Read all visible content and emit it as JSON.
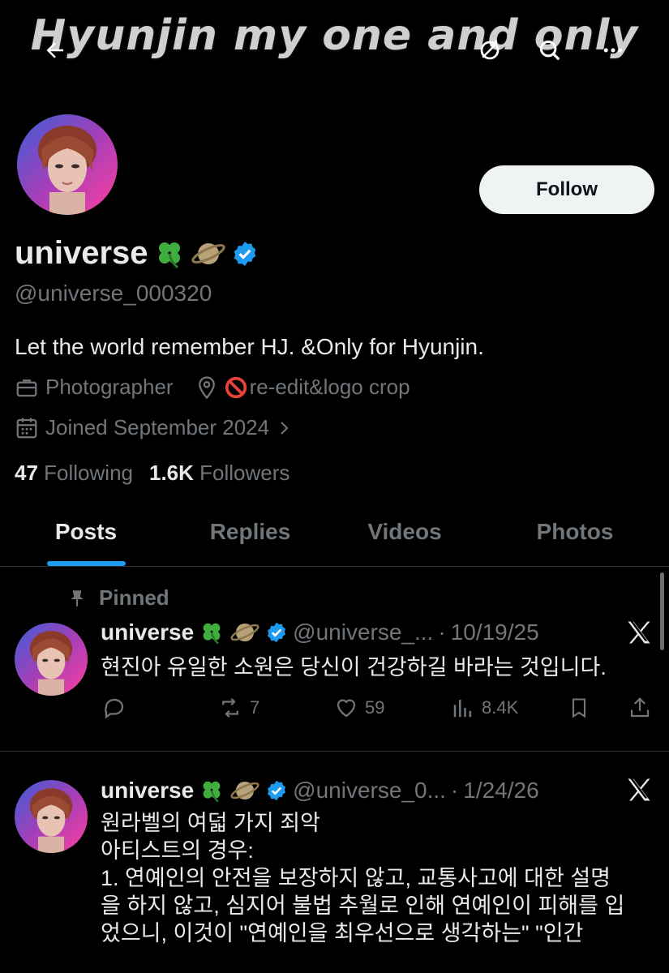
{
  "banner": {
    "title": "Hyunjin my one and only"
  },
  "header": {
    "back": "back",
    "refresh": "refresh",
    "search": "search",
    "more": "more"
  },
  "profile": {
    "display_name": "universe",
    "handle": "@universe_000320",
    "bio": "Let the world remember HJ. &Only for Hyunjin.",
    "category": "Photographer",
    "location": "re-edit&logo crop",
    "joined": "Joined September 2024",
    "following_count": "47",
    "following_label": "Following",
    "followers_count": "1.6K",
    "followers_label": "Followers",
    "follow_button": "Follow"
  },
  "tabs": [
    {
      "label": "Posts",
      "active": true
    },
    {
      "label": "Replies",
      "active": false
    },
    {
      "label": "Videos",
      "active": false
    },
    {
      "label": "Photos",
      "active": false
    }
  ],
  "posts": [
    {
      "pinned_label": "Pinned",
      "name": "universe",
      "handle": "@universe_...",
      "sep": "·",
      "date": "10/19/25",
      "text": "현진아 유일한 소원은 당신이 건강하길 바라는 것입니다.",
      "replies": "",
      "reposts": "7",
      "likes": "59",
      "views": "8.4K"
    },
    {
      "name": "universe",
      "handle": "@universe_0...",
      "sep": "·",
      "date": "1/24/26",
      "lines": [
        "원라벨의 여덟 가지 죄악",
        "아티스트의 경우:",
        "1. 연예인의 안전을 보장하지 않고, 교통사고에 대한 설명",
        "을 하지 않고, 심지어 불법 추월로 인해 연예인이 피해를 입",
        "었으니, 이것이 \"연예인을 최우선으로 생각하는\" \"인간"
      ]
    }
  ],
  "colors": {
    "accent": "#1d9bf0",
    "muted": "#71767b",
    "text": "#e7e9ea",
    "verified": "#1d9bf0",
    "follow_bg": "#eff3f4"
  }
}
